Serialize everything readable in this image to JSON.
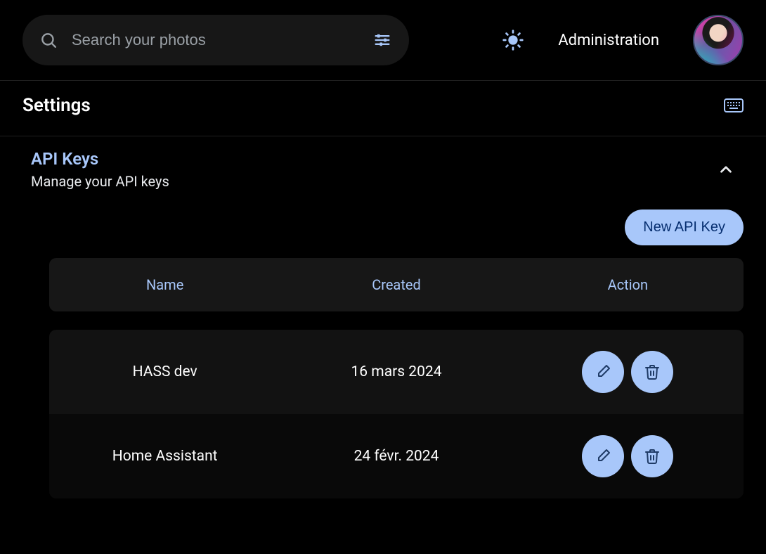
{
  "search": {
    "placeholder": "Search your photos"
  },
  "header": {
    "admin_label": "Administration"
  },
  "settings": {
    "title": "Settings"
  },
  "section": {
    "title": "API Keys",
    "subtitle": "Manage your API keys",
    "new_button": "New API Key"
  },
  "table": {
    "columns": {
      "name": "Name",
      "created": "Created",
      "action": "Action"
    },
    "rows": [
      {
        "name": "HASS dev",
        "created": "16 mars 2024"
      },
      {
        "name": "Home Assistant",
        "created": "24 févr. 2024"
      }
    ]
  }
}
